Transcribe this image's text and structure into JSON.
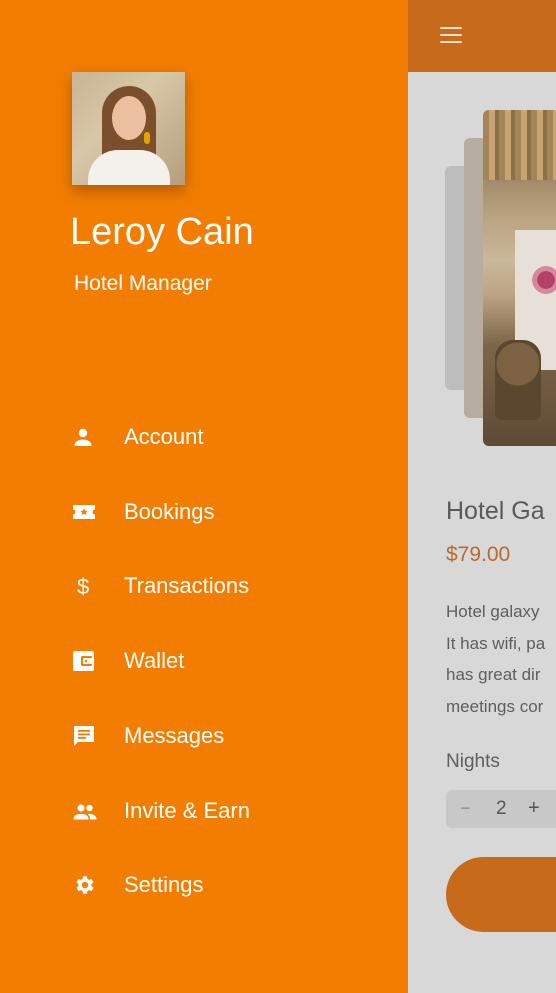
{
  "colors": {
    "drawer_bg": "#f37d00",
    "accent": "#c76a1a",
    "price": "#b56c2a"
  },
  "profile": {
    "name": "Leroy Cain",
    "role": "Hotel Manager"
  },
  "menu": [
    {
      "label": "Account",
      "icon": "person-icon"
    },
    {
      "label": "Bookings",
      "icon": "ticket-icon"
    },
    {
      "label": "Transactions",
      "icon": "dollar-icon"
    },
    {
      "label": "Wallet",
      "icon": "wallet-icon"
    },
    {
      "label": "Messages",
      "icon": "message-icon"
    },
    {
      "label": "Invite & Earn",
      "icon": "people-icon"
    },
    {
      "label": "Settings",
      "icon": "gear-icon"
    }
  ],
  "main": {
    "menu_icon": "hamburger-icon",
    "hotel_title": "Hotel Ga",
    "price": "$79.00",
    "description_lines": [
      "Hotel galaxy",
      "It has wifi, pa",
      "has great dir",
      "meetings cor"
    ],
    "nights_label": "Nights",
    "stepper": {
      "minus": "−",
      "value": "2",
      "plus": "+"
    }
  }
}
